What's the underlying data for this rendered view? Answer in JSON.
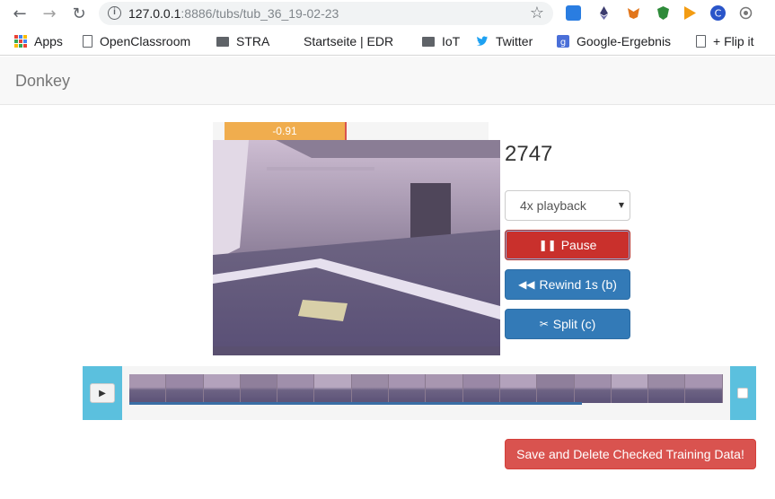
{
  "browser": {
    "url_host": "127.0.0.1",
    "url_path": ":8886/tubs/tub_36_19-02-23",
    "bookmarks": [
      "Apps",
      "OpenClassroom",
      "STRA",
      "Startseite | EDR",
      "IoT",
      "Twitter",
      "Google-Ergebnis",
      "+ Flip it"
    ]
  },
  "app": {
    "brand": "Donkey"
  },
  "player": {
    "steering_label": "-0.91",
    "steering_fill_fraction": 0.457,
    "frame_number": "2747",
    "playback_selected": "4x playback",
    "pause_label": "Pause",
    "rewind_label": "Rewind 1s (b)",
    "split_label": "Split (c)"
  },
  "timeline": {
    "progress_fraction": 0.763,
    "thumb_count": 16
  },
  "actions": {
    "save_delete_label": "Save and Delete Checked Training Data!"
  },
  "colors": {
    "warning": "#f0ad4e",
    "danger": "#d9534f",
    "primary": "#337ab7",
    "info": "#5bc0de"
  }
}
